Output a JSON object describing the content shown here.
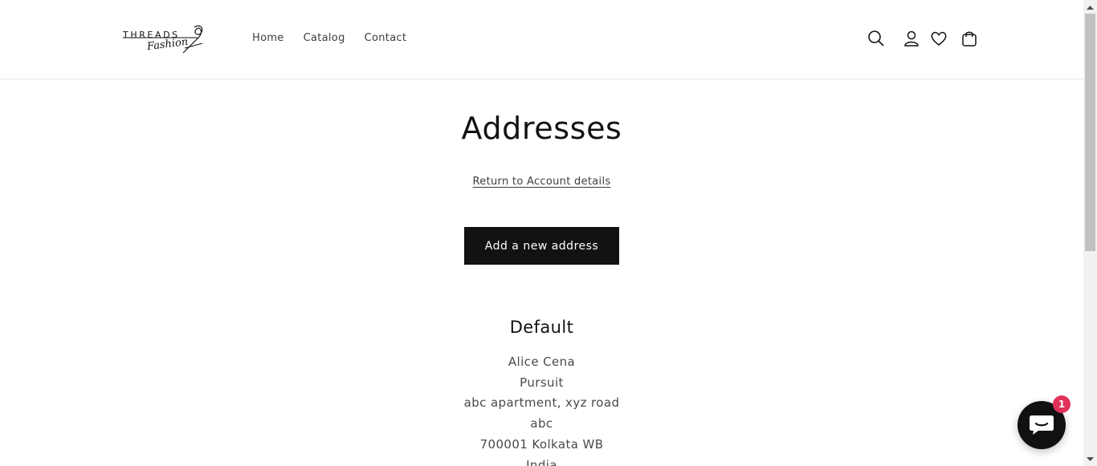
{
  "header": {
    "logo": {
      "word": "THREADS",
      "script": "Fashion"
    },
    "nav": [
      {
        "label": "Home"
      },
      {
        "label": "Catalog"
      },
      {
        "label": "Contact"
      }
    ],
    "icons": [
      "search-icon",
      "account-icon",
      "wishlist-heart-icon",
      "cart-icon"
    ]
  },
  "main": {
    "title": "Addresses",
    "return_link": "Return to Account details",
    "add_button": "Add a new address",
    "default_heading": "Default",
    "address_lines": [
      "Alice Cena",
      "Pursuit",
      "abc apartment, xyz road",
      "abc",
      "700001 Kolkata WB",
      "India"
    ]
  },
  "chat": {
    "badge_count": "1",
    "icon": "chat-bubble-icon",
    "color": "#111111",
    "badge_color": "#e0315a"
  }
}
